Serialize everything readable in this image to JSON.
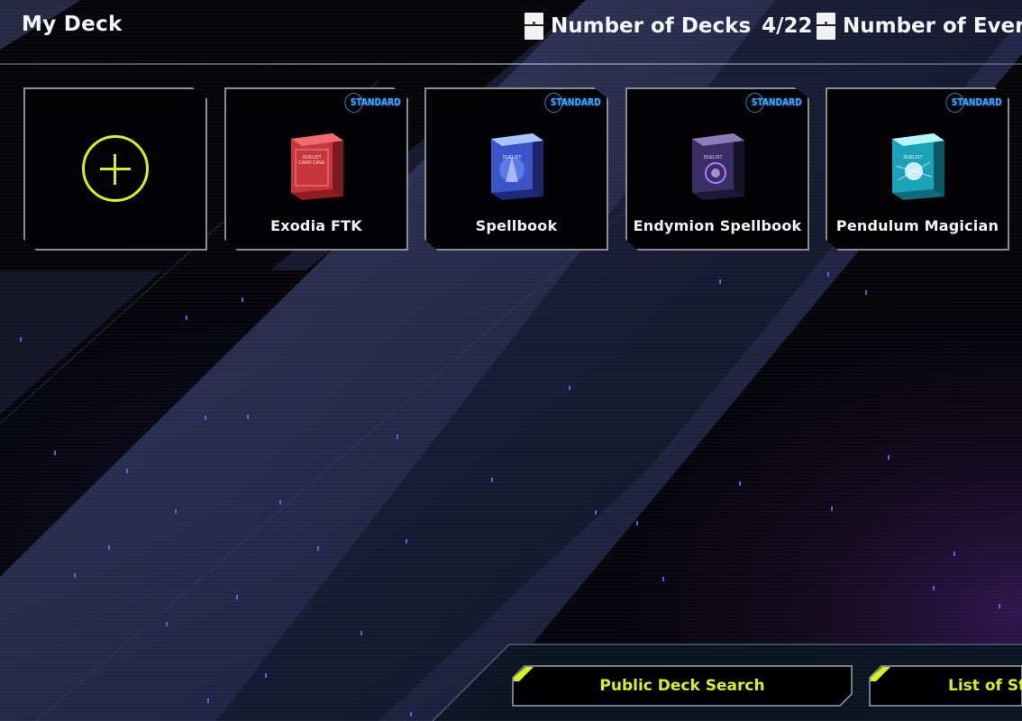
{
  "header": {
    "title": "My Deck",
    "stats": [
      {
        "label": "Number of Decks",
        "value": "4/22"
      },
      {
        "label": "Number of Event",
        "value": ""
      }
    ]
  },
  "add_tile": {
    "icon": "plus-circle-icon"
  },
  "decks": [
    {
      "name": "Exodia FTK",
      "badge": "STANDARD",
      "box_color": "#c8353d",
      "box_accent": "#ef6b6e",
      "icon": "deck-box-icon"
    },
    {
      "name": "Spellbook",
      "badge": "STANDARD",
      "box_color": "#3b55c9",
      "box_accent": "#a7c6ff",
      "icon": "deck-box-icon"
    },
    {
      "name": "Endymion Spellbook",
      "badge": "STANDARD",
      "box_color": "#3a2e66",
      "box_accent": "#b07cff",
      "icon": "deck-box-icon"
    },
    {
      "name": "Pendulum Magician",
      "badge": "STANDARD",
      "box_color": "#1aa2b8",
      "box_accent": "#b6f4ff",
      "icon": "deck-box-icon"
    }
  ],
  "bottom_buttons": [
    {
      "label": "Public Deck Search"
    },
    {
      "label": "List of Str"
    }
  ],
  "colors": {
    "accent": "#d7ee1f",
    "badge": "#3da6ff",
    "tile_border": "#8a8d96"
  }
}
